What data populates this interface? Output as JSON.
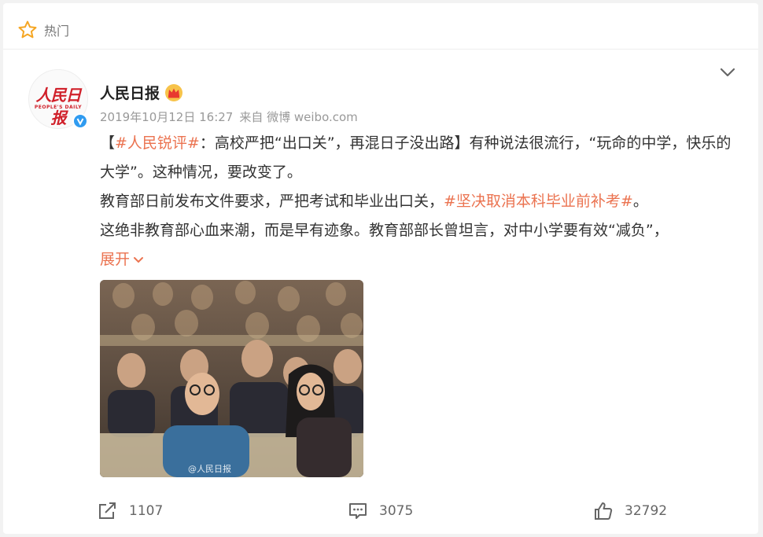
{
  "header": {
    "label": "热门"
  },
  "post": {
    "author": "人民日报",
    "avatar_logo": "人民日报",
    "avatar_sub": "PEOPLE'S DAILY",
    "timestamp": "2019年10月12日 16:27",
    "source": "来自 微博 weibo.com",
    "text": {
      "open_bracket": "【",
      "tag1": "#人民锐评#",
      "part1": "：高校严把“出口关”，再混日子没出路】有种说法很流行，“玩命的中学，快乐的大学”。这种情况，要改变了。",
      "part2": "教育部日前发布文件要求，严把考试和毕业出口关，",
      "tag2": "#坚决取消本科毕业前补考#",
      "part2_end": "。",
      "part3": "这绝非教育部心血来潮，而是早有迹象。教育部部长曾坦言，对中小学要有效“减负”，",
      "expand_label": "展开"
    },
    "image": {
      "watermark": "@人民日报"
    }
  },
  "actions": {
    "repost_count": "1107",
    "comment_count": "3075",
    "like_count": "32792"
  },
  "colors": {
    "accent": "#eb7350",
    "verified": "#2f9bf0",
    "logo_red": "#d0202a"
  }
}
